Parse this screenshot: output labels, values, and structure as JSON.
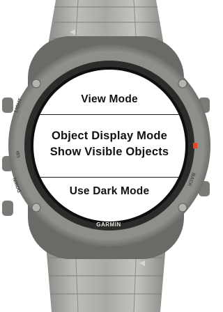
{
  "device": {
    "brand": "GARMIN",
    "bezel_labels": {
      "left_top": "LIGHT",
      "left_mid": "UP",
      "left_low": "DOWN",
      "right_mid": "BACK"
    }
  },
  "menu": {
    "items": [
      {
        "label": "View Mode"
      },
      {
        "label_line1": "Object Display Mode",
        "label_line2": "Show Visible Objects"
      },
      {
        "label": "Use Dark Mode"
      }
    ]
  },
  "colors": {
    "screen_background": "#ffffff",
    "text": "#111111",
    "accent": "#e8432a",
    "bezel": "#8a8a86",
    "band": "#a7a7a2"
  }
}
